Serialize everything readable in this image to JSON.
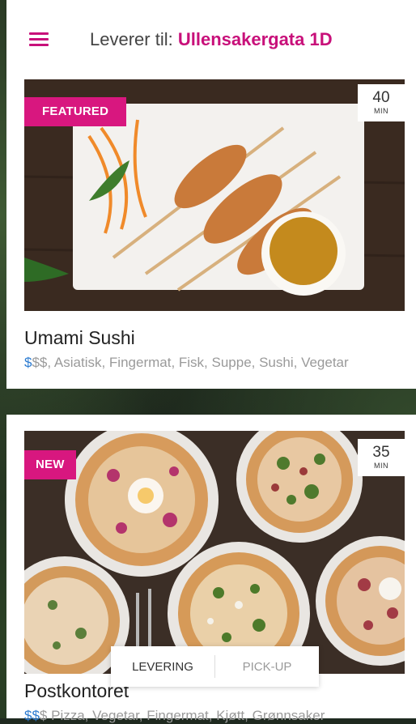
{
  "header": {
    "deliver_prefix": "Leverer til:",
    "address": "Ullensakergata 1D"
  },
  "restaurants": [
    {
      "badge": "FEATURED",
      "time_value": "40",
      "time_unit": "MIN",
      "name": "Umami Sushi",
      "price_active": "$",
      "price_rest": "$$",
      "tags": ", Asiatisk, Fingermat, Fisk, Suppe, Sushi, Vegetar"
    },
    {
      "badge": "NEW",
      "time_value": "35",
      "time_unit": "MIN",
      "name": "Postkontoret",
      "price_active": "$$",
      "price_rest": "$",
      "tags": " Pizza, Vegetar, Fingermat, Kjøtt, Grønnsaker"
    }
  ],
  "delivery_mode": {
    "levering": "LEVERING",
    "pickup": "PICK-UP"
  },
  "colors": {
    "accent": "#c8107a",
    "badge": "#d8177f",
    "price_active": "#2a7ad0"
  },
  "icons": {
    "menu": "hamburger-menu-icon"
  }
}
